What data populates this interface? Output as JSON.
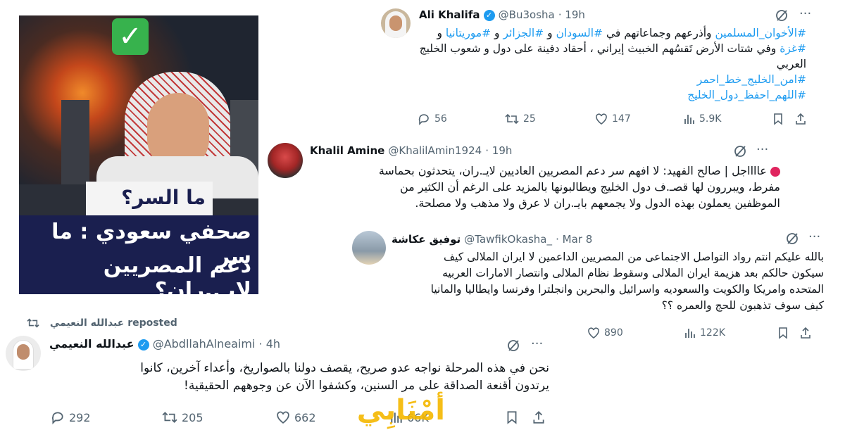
{
  "thumb": {
    "caption_top": "ما السر؟",
    "caption_main_1": "صحفي سعودي : ما سر",
    "caption_main_2": "دعم المصريين لإيـ..ران؟"
  },
  "tweet1": {
    "name": "Ali Khalifa",
    "handle": "@Bu3osha",
    "time": "· 19h",
    "line1_prefix": "و",
    "line1_tag_a": "#موريتانيا",
    "line1_mid_a": " و ",
    "line1_tag_b": "#الجزائر",
    "line1_mid_b": " و ",
    "line1_tag_c": "#السودان",
    "line1_mid_c": " وأذرعهم وجماعاتهم في ",
    "line1_tag_d": "#الأخوان_المسلمين",
    "line2_tag": "#غزة",
    "line2_text": " وفي شتات الأرض تَقسُهم الخبيث إيراني ، أحقاد دفينة على دول و شعوب الخليج",
    "line3": "العربي",
    "tag_line4": "#امن_الخليج_خط_احمر",
    "tag_line5": "#اللهم_احفظ_دول_الخليج",
    "replies": "56",
    "reposts": "25",
    "likes": "147",
    "views": "5.9K"
  },
  "tweet2": {
    "name": "Khalil Amine",
    "handle": "@KhalilAmin1924",
    "time": "· 19h",
    "line1": "عااااجل | صالح الفهيد: لا افهم سر دعم المصريين العاديين لايـ.ران، يتحدثون بحماسة",
    "line2": "مفرط، ويبررون لها قصـ.ف دول الخليج ويطالبونها بالمزيد على الرغم أن الكثير من",
    "line3": "الموظفين يعملون بهذه الدول ولا يجمعهم بايـ.ران لا عرق ولا مذهب ولا مصلحة."
  },
  "tweet3": {
    "name": "توفيق عكاشة",
    "handle": "@TawfikOkasha_",
    "time": "· Mar 8",
    "line1": "بالله عليكم انتم رواد التواصل الاجتماعى من المصريين الداعمين لا ايران الملالى كيف",
    "line2": "سيكون حالكم بعد هزيمة ايران الملالى وسقوط نظام الملالى وانتصار الامارات العربيه",
    "line3": "المتحده وامريكا والكويت والسعوديه واسرائيل والبحرين وانجلترا وفرنسا وايطاليا والمانيا",
    "line4": "كيف سوف تذهبون للحج والعمره ؟؟",
    "likes": "890",
    "views": "122K"
  },
  "tweet4": {
    "repost_label": "reposted",
    "repost_name": "عبدالله النعيمي",
    "name": "عبدالله النعيمي",
    "handle": "@AbdllahAlneaimi",
    "time": "· 4h",
    "line1": "نحن في هذه المرحلة نواجه عدو صريح، يقصف دولنا بالصواريخ، وأعداء آخرين، كانوا",
    "line2": "يرتدون أقنعة الصداقة على مر السنين، وكشفوا الآن عن وجوههم الحقيقية!",
    "replies": "292",
    "reposts": "205",
    "likes": "662",
    "views": "66K"
  },
  "watermark": {
    "text": "أمْنَابِي"
  },
  "colors": {
    "accent": "#1d9bf0",
    "muted": "#536471",
    "thumb_banner": "#1a1f4f",
    "thumb_label_bg": "#f4f4f4",
    "check_green": "#37b24d",
    "watermark_yellow": "#f5b800"
  }
}
